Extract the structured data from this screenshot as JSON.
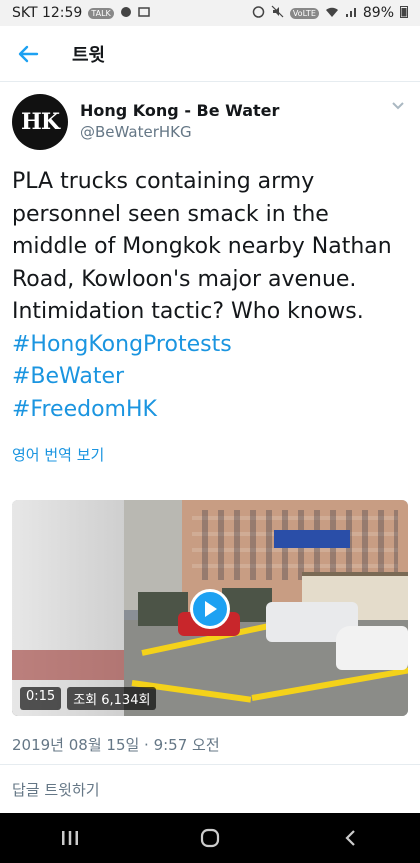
{
  "status_bar": {
    "carrier_time": "SKT 12:59",
    "talk_badge": "TALK",
    "lte_badge": "VoLTE",
    "battery": "89%"
  },
  "header": {
    "title": "트윗",
    "back_icon": "arrow-left-icon"
  },
  "tweet": {
    "author": {
      "avatar_text": "HK",
      "display_name": "Hong Kong - Be Water",
      "handle": "@BeWaterHKG"
    },
    "text_lines": [
      "PLA trucks containing army",
      "personnel seen smack in the",
      "middle of Mongkok nearby Nathan",
      "Road, Kowloon's major avenue.",
      "Intimidation tactic? Who knows."
    ],
    "hashtags": [
      "#HongKongProtests",
      "#BeWater",
      "#FreedomHK"
    ],
    "translate_label": "영어 번역 보기",
    "video": {
      "duration": "0:15",
      "views": "조회 6,134회"
    },
    "timestamp": "2019년 08월 15일 · 9:57 오전",
    "reply_label": "답글 트윗하기"
  },
  "colors": {
    "accent": "#1b95e0",
    "play_button": "#1da1f2",
    "secondary_text": "#657786"
  }
}
